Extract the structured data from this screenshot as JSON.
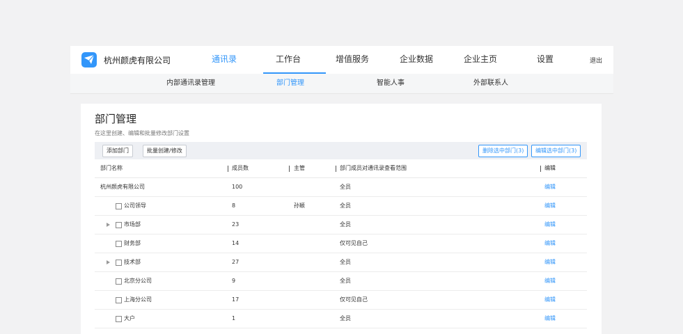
{
  "header": {
    "company": "杭州颜虎有限公司",
    "logo_icon": "paper-plane-icon",
    "logout": "退出",
    "accent_color": "#3296fa",
    "nav": [
      {
        "label": "通讯录",
        "active": true
      },
      {
        "label": "工作台",
        "active": false
      },
      {
        "label": "增值服务",
        "active": false
      },
      {
        "label": "企业数据",
        "active": false
      },
      {
        "label": "企业主页",
        "active": false
      },
      {
        "label": "设置",
        "active": false
      }
    ]
  },
  "subnav": [
    {
      "label": "内部通讯录管理",
      "active": false
    },
    {
      "label": "部门管理",
      "active": true
    },
    {
      "label": "智能人事",
      "active": false
    },
    {
      "label": "外部联系人",
      "active": false
    }
  ],
  "page": {
    "title": "部门管理",
    "description": "在这里创建、编辑和批量修改部门设置"
  },
  "toolbar": {
    "add_label": "添加部门",
    "batch_label": "批量创建/修改",
    "delete_selected_label": "删除选中部门(3)",
    "edit_selected_label": "编辑选中部门(3)"
  },
  "table": {
    "headers": {
      "name": "部门名称",
      "members": "成员数",
      "manager": "主管",
      "scope": "部门成员对通讯录查看范围",
      "edit": "编辑"
    },
    "rows": [
      {
        "name": "杭州颜虎有限公司",
        "members": "100",
        "manager": "",
        "scope": "全员",
        "edit": "编辑",
        "level": 0,
        "checkbox": false,
        "expandable": false
      },
      {
        "name": "公司领导",
        "members": "8",
        "manager": "孙颖",
        "scope": "全员",
        "edit": "编辑",
        "level": 1,
        "checkbox": true,
        "expandable": false
      },
      {
        "name": "市场部",
        "members": "23",
        "manager": "",
        "scope": "全员",
        "edit": "编辑",
        "level": 1,
        "checkbox": true,
        "expandable": true
      },
      {
        "name": "财务部",
        "members": "14",
        "manager": "",
        "scope": "仅可见自己",
        "edit": "编辑",
        "level": 1,
        "checkbox": true,
        "expandable": false
      },
      {
        "name": "技术部",
        "members": "27",
        "manager": "",
        "scope": "全员",
        "edit": "编辑",
        "level": 1,
        "checkbox": true,
        "expandable": true
      },
      {
        "name": "北京分公司",
        "members": "9",
        "manager": "",
        "scope": "全员",
        "edit": "编辑",
        "level": 1,
        "checkbox": true,
        "expandable": false
      },
      {
        "name": "上海分公司",
        "members": "17",
        "manager": "",
        "scope": "仅可见自己",
        "edit": "编辑",
        "level": 1,
        "checkbox": true,
        "expandable": false
      },
      {
        "name": "大户",
        "members": "1",
        "manager": "",
        "scope": "全员",
        "edit": "编辑",
        "level": 1,
        "checkbox": true,
        "expandable": false
      }
    ]
  }
}
